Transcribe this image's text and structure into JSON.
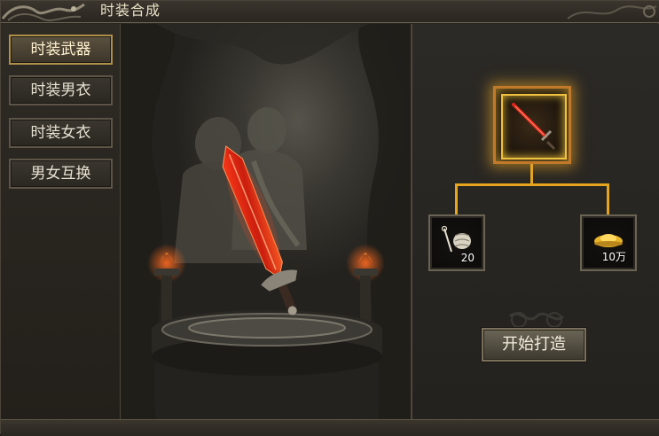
{
  "window": {
    "title": "时装合成"
  },
  "tabs": [
    {
      "label": "时装武器",
      "active": true
    },
    {
      "label": "时装男衣",
      "active": false
    },
    {
      "label": "时装女衣",
      "active": false
    },
    {
      "label": "男女互换",
      "active": false
    }
  ],
  "craft": {
    "result_item_icon": "red-sword-icon",
    "materials": [
      {
        "icon": "thread-spool-icon",
        "count": "20"
      },
      {
        "icon": "gold-ingot-icon",
        "count": "10万"
      }
    ],
    "forge_button_label": "开始打造"
  },
  "colors": {
    "accent_gold": "#e6a51f",
    "slot_glow": "#f0c040",
    "sword_red": "#e0261a"
  }
}
